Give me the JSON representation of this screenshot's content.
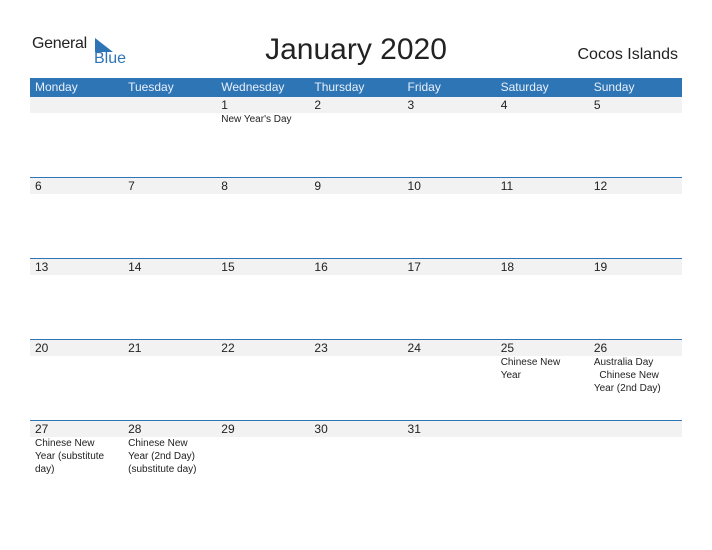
{
  "logo": {
    "line1": "General",
    "line2": "Blue"
  },
  "title": "January 2020",
  "country": "Cocos Islands",
  "colors": {
    "accent": "#2e75b6",
    "strip": "#f2f2f2"
  },
  "weekdays": [
    "Monday",
    "Tuesday",
    "Wednesday",
    "Thursday",
    "Friday",
    "Saturday",
    "Sunday"
  ],
  "weeks": [
    [
      {
        "d": "",
        "e": ""
      },
      {
        "d": "",
        "e": ""
      },
      {
        "d": "1",
        "e": "New Year's Day"
      },
      {
        "d": "2",
        "e": ""
      },
      {
        "d": "3",
        "e": ""
      },
      {
        "d": "4",
        "e": ""
      },
      {
        "d": "5",
        "e": ""
      }
    ],
    [
      {
        "d": "6",
        "e": ""
      },
      {
        "d": "7",
        "e": ""
      },
      {
        "d": "8",
        "e": ""
      },
      {
        "d": "9",
        "e": ""
      },
      {
        "d": "10",
        "e": ""
      },
      {
        "d": "11",
        "e": ""
      },
      {
        "d": "12",
        "e": ""
      }
    ],
    [
      {
        "d": "13",
        "e": ""
      },
      {
        "d": "14",
        "e": ""
      },
      {
        "d": "15",
        "e": ""
      },
      {
        "d": "16",
        "e": ""
      },
      {
        "d": "17",
        "e": ""
      },
      {
        "d": "18",
        "e": ""
      },
      {
        "d": "19",
        "e": ""
      }
    ],
    [
      {
        "d": "20",
        "e": ""
      },
      {
        "d": "21",
        "e": ""
      },
      {
        "d": "22",
        "e": ""
      },
      {
        "d": "23",
        "e": ""
      },
      {
        "d": "24",
        "e": ""
      },
      {
        "d": "25",
        "e": "Chinese New Year"
      },
      {
        "d": "26",
        "e": "Australia Day\n  Chinese New Year (2nd Day)"
      }
    ],
    [
      {
        "d": "27",
        "e": "Chinese New Year (substitute day)"
      },
      {
        "d": "28",
        "e": "Chinese New Year (2nd Day) (substitute day)"
      },
      {
        "d": "29",
        "e": ""
      },
      {
        "d": "30",
        "e": ""
      },
      {
        "d": "31",
        "e": ""
      },
      {
        "d": "",
        "e": ""
      },
      {
        "d": "",
        "e": ""
      }
    ]
  ]
}
